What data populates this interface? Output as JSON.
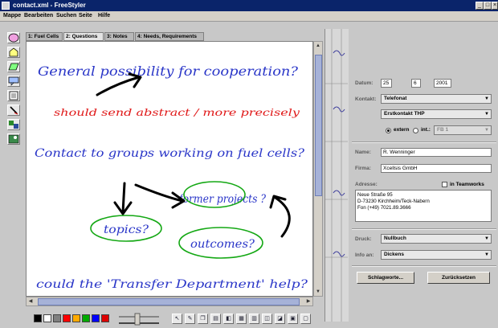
{
  "window": {
    "title": "contact.xml - FreeStyler",
    "minimize": "_",
    "maximize": "□",
    "close": "×"
  },
  "menu": [
    "Mappe",
    "Bearbeiten",
    "Suchen",
    "Seite",
    "Hilfe"
  ],
  "tabs": [
    "1: Fuel Cells",
    "2: Questions",
    "3: Notes",
    "4: Needs, Requirements"
  ],
  "handwriting": [
    {
      "text": "General possibility for cooperation?",
      "color": "#2a36c8"
    },
    {
      "text": "should send abstract / more precisely",
      "color": "#e01818"
    },
    {
      "text": "Contact to groups working on fuel cells?",
      "color": "#2a36c8"
    },
    {
      "text": "former projects ?",
      "color": "#2a36c8"
    },
    {
      "text": "topics?",
      "color": "#2a36c8"
    },
    {
      "text": "outcomes?",
      "color": "#2a36c8"
    },
    {
      "text": "could the 'Transfer Department' help?",
      "color": "#2a36c8"
    }
  ],
  "ink": {
    "black": "#000000",
    "green": "#14a814"
  },
  "form": {
    "datum_label": "Datum:",
    "datum_day": "25",
    "datum_month": "6",
    "datum_year": "2001",
    "kontakt_label": "Kontakt:",
    "kontakt_value": "Telefonat",
    "kontakt2_value": "Erstkontakt THP",
    "extern_label": "extern",
    "int_label": "int.:",
    "int_value": "FB 1",
    "name_label": "Name:",
    "name_value": "R. Wenninger",
    "firma_label": "Firma:",
    "firma_value": "Xcellsis GmbH",
    "adresse_label": "Adresse:",
    "teamworks_label": "in Teamworks",
    "address_lines": [
      "Neue Straße 95",
      "D-73230 Kirchheim/Teck-Nabern",
      "Fon (+49) 7021.89.3666"
    ],
    "druck_label": "Druck:",
    "druck_value": "Nullbuch",
    "info_label": "Info an:",
    "info_value": "Dickens",
    "schlagworte_button": "Schlagworte...",
    "zuruecksetzen_button": "Zurücksetzen"
  },
  "palette": [
    "#000000",
    "#ffffff",
    "#808080",
    "#ff0000",
    "#ffaa00",
    "#00aa00",
    "#0000ff",
    "#dd0000"
  ],
  "accent": "#0a246a"
}
